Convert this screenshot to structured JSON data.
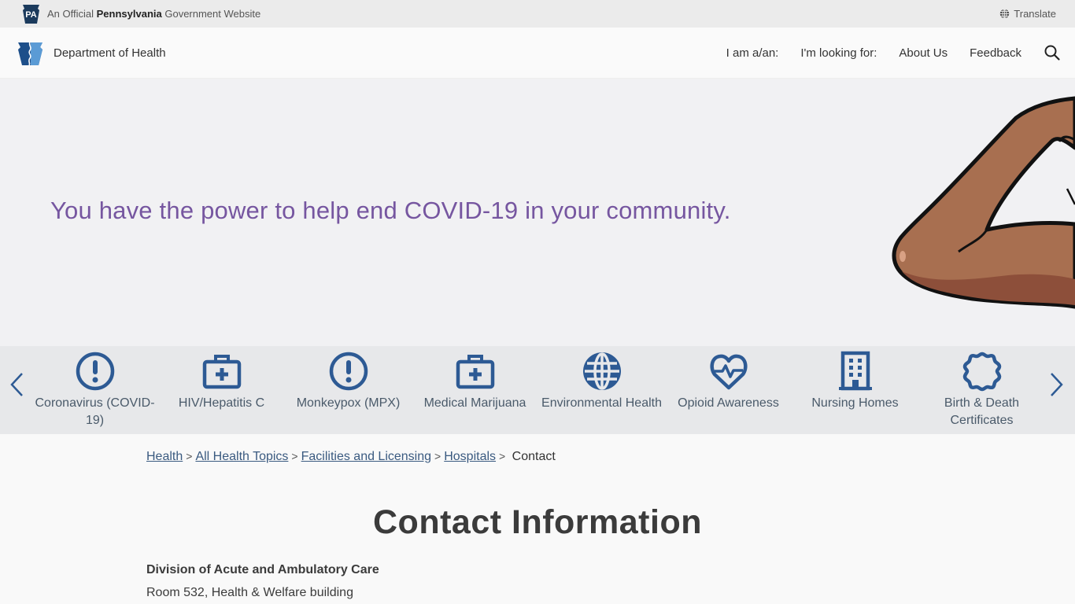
{
  "topbar": {
    "badge_text": "PA",
    "official_prefix": "An Official ",
    "official_state": "Pennsylvania",
    "official_suffix": " Government Website",
    "translate_label": "Translate"
  },
  "header": {
    "brand_name": "Department of Health",
    "nav": [
      {
        "label": "I am a/an:"
      },
      {
        "label": "I'm looking for:"
      },
      {
        "label": "About Us"
      },
      {
        "label": "Feedback"
      }
    ]
  },
  "hero": {
    "headline": "You have the power to help end COVID-19 in your community."
  },
  "topics": [
    {
      "label": "Coronavirus (COVID-19)",
      "icon": "exclamation-circle-icon"
    },
    {
      "label": "HIV/Hepatitis C",
      "icon": "medical-kit-icon"
    },
    {
      "label": "Monkeypox (MPX)",
      "icon": "exclamation-circle-icon"
    },
    {
      "label": "Medical Marijuana",
      "icon": "medical-kit-icon"
    },
    {
      "label": "Environmental Health",
      "icon": "globe-icon"
    },
    {
      "label": "Opioid Awareness",
      "icon": "heart-pulse-icon"
    },
    {
      "label": "Nursing Homes",
      "icon": "building-icon"
    },
    {
      "label": "Birth & Death Certificates",
      "icon": "certificate-seal-icon"
    }
  ],
  "breadcrumb": {
    "links": [
      "Health",
      "All Health Topics",
      "Facilities and Licensing",
      "Hospitals"
    ],
    "separator": ">",
    "current": "Contact"
  },
  "content": {
    "title": "Contact Information",
    "division": "Division of Acute and Ambulatory Care",
    "address_line": "Room 532, Health & Welfare building"
  },
  "colors": {
    "accent_purple": "#7656a0",
    "icon_blue": "#2d5a94",
    "link_blue": "#3a5a80"
  }
}
